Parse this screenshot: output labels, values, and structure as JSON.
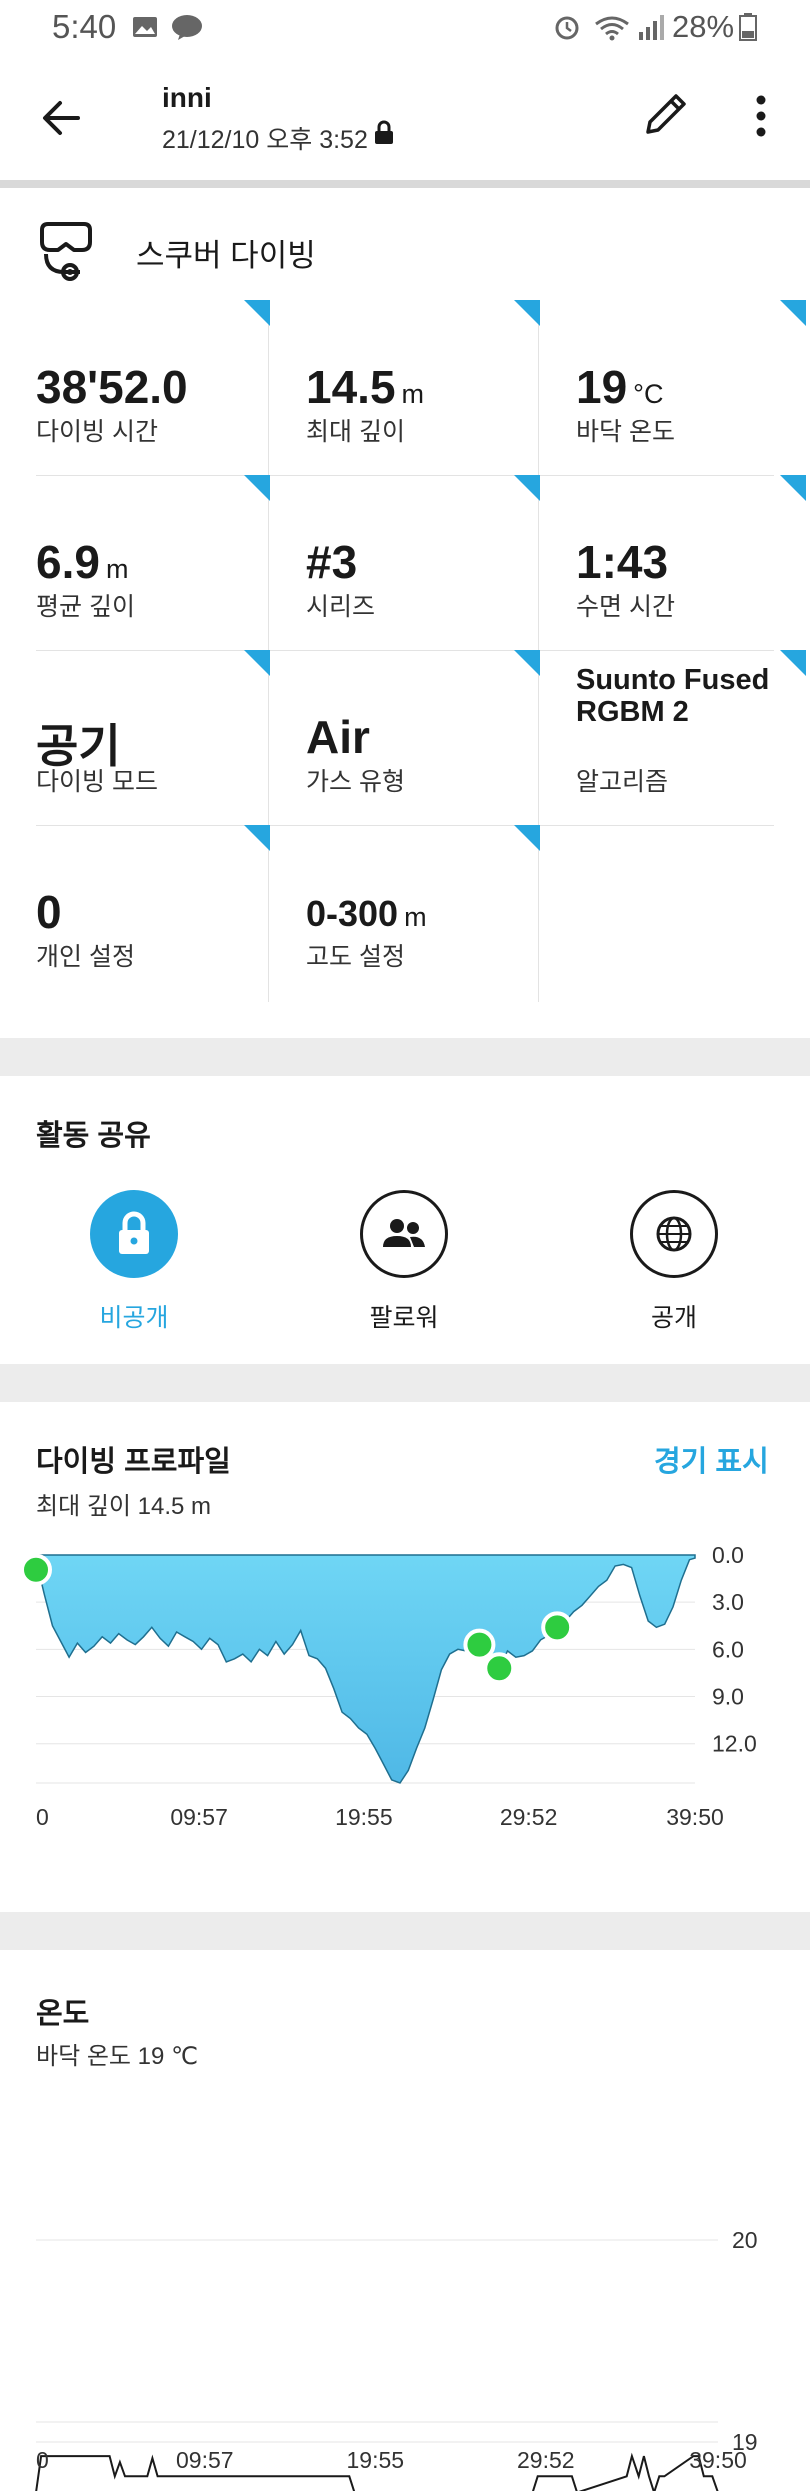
{
  "status_bar": {
    "time": "5:40",
    "battery": "28%"
  },
  "header": {
    "title": "inni",
    "subtitle": "21/12/10 오후 3:52"
  },
  "activity": {
    "type_label": "스쿠버 다이빙"
  },
  "stats": [
    {
      "value": "38'52.0",
      "unit": "",
      "label": "다이빙 시간"
    },
    {
      "value": "14.5",
      "unit": "m",
      "label": "최대 깊이"
    },
    {
      "value": "19",
      "unit": "°C",
      "label": "바닥 온도"
    },
    {
      "value": "6.9",
      "unit": "m",
      "label": "평균 깊이"
    },
    {
      "value": "#3",
      "unit": "",
      "label": "시리즈"
    },
    {
      "value": "1:43",
      "unit": "",
      "label": "수면 시간"
    },
    {
      "value": "공기",
      "unit": "",
      "label": "다이빙 모드"
    },
    {
      "value": "Air",
      "unit": "",
      "label": "가스 유형"
    },
    {
      "value": "Suunto Fused RGBM 2",
      "unit": "",
      "label": "알고리즘"
    },
    {
      "value": "0",
      "unit": "",
      "label": "개인 설정"
    },
    {
      "value": "0-300",
      "unit": "m",
      "label": "고도 설정"
    }
  ],
  "share": {
    "title": "활동 공유",
    "options": [
      {
        "label": "비공개",
        "selected": true
      },
      {
        "label": "팔로워",
        "selected": false
      },
      {
        "label": "공개",
        "selected": false
      }
    ]
  },
  "dive_profile": {
    "title": "다이빙 프로파일",
    "subtitle": "최대 깊이 14.5 m",
    "action_label": "경기 표시"
  },
  "temperature": {
    "title": "온도",
    "subtitle": "바닥 온도 19 ℃"
  },
  "colors": {
    "accent": "#26a6df",
    "depth_fill": "#5cc9ee",
    "marker": "#2ecc40"
  },
  "chart_data": [
    {
      "type": "area",
      "title": "다이빙 프로파일",
      "x_tick_labels": [
        "0",
        "09:57",
        "19:55",
        "29:52",
        "39:50"
      ],
      "y_tick_labels": [
        "0.0",
        "3.0",
        "6.0",
        "9.0",
        "12.0"
      ],
      "ylim": [
        0,
        14.5
      ],
      "y_inverted": true,
      "x_minutes": [
        0,
        0.5,
        1,
        1.5,
        2,
        2.5,
        3,
        3.5,
        4,
        4.5,
        5,
        5.5,
        6,
        6.5,
        7,
        7.5,
        8,
        8.5,
        9,
        9.5,
        10,
        10.5,
        11,
        11.5,
        12,
        12.5,
        13,
        13.5,
        14,
        14.5,
        15,
        15.5,
        16,
        16.5,
        17,
        17.5,
        18,
        18.5,
        19,
        19.5,
        20,
        20.5,
        21,
        21.5,
        22,
        22.5,
        23,
        23.5,
        24,
        24.5,
        25,
        25.5,
        26,
        26.5,
        27,
        27.5,
        28,
        28.5,
        29,
        29.5,
        30,
        30.5,
        31,
        31.5,
        32,
        32.5,
        33,
        33.5,
        34,
        34.5,
        35,
        35.5,
        36,
        36.5,
        37,
        37.5,
        38,
        38.5,
        39,
        39.5,
        39.83
      ],
      "depth_m": [
        0.3,
        2.5,
        4.5,
        5.5,
        6.5,
        5.6,
        6.2,
        5.8,
        5.2,
        5.6,
        5.0,
        5.4,
        5.7,
        5.2,
        4.6,
        5.3,
        5.8,
        4.9,
        5.2,
        5.5,
        6.0,
        5.3,
        5.7,
        6.8,
        6.6,
        6.3,
        6.8,
        6.0,
        6.4,
        5.5,
        6.3,
        5.7,
        4.8,
        6.4,
        6.6,
        7.2,
        8.5,
        10.0,
        10.4,
        11.0,
        11.4,
        12.3,
        13.3,
        14.3,
        14.5,
        13.7,
        12.3,
        11.0,
        9.2,
        7.3,
        6.3,
        6.0,
        6.1,
        5.7,
        5.7,
        6.6,
        7.2,
        6.1,
        6.5,
        6.4,
        6.1,
        5.4,
        5.1,
        4.6,
        4.2,
        3.6,
        3.2,
        2.6,
        2.0,
        1.6,
        0.7,
        0.6,
        0.8,
        2.6,
        4.2,
        4.6,
        4.4,
        3.3,
        1.6,
        0.3,
        0.2
      ],
      "markers_minutes": [
        0,
        26.8,
        28,
        31.5
      ]
    },
    {
      "type": "line",
      "title": "온도",
      "x_tick_labels": [
        "0",
        "09:57",
        "19:55",
        "29:52",
        "39:50"
      ],
      "y_tick_labels": [
        "20",
        "19"
      ],
      "ylim": [
        18.6,
        20
      ],
      "x_minutes": [
        0,
        0.3,
        1.7,
        2,
        4.3,
        4.6,
        4.9,
        5.2,
        6.5,
        6.8,
        7.1,
        7.4,
        18.3,
        18.6,
        23.3,
        23.6,
        24.0,
        24.3,
        29.0,
        29.3,
        31.3,
        31.6,
        34.5,
        34.8,
        35.2,
        35.5,
        35.8,
        36.1,
        36.4,
        36.7,
        38.4,
        38.7,
        39.0,
        39.5,
        39.83
      ],
      "temp_c": [
        18.75,
        18.93,
        18.93,
        18.93,
        18.93,
        18.83,
        18.9,
        18.83,
        18.83,
        18.92,
        18.83,
        18.83,
        18.83,
        18.75,
        18.75,
        18.68,
        18.75,
        18.75,
        18.75,
        18.83,
        18.83,
        18.75,
        18.83,
        18.93,
        18.83,
        18.93,
        18.83,
        18.75,
        18.83,
        18.83,
        18.93,
        18.93,
        18.83,
        18.83,
        18.75
      ]
    }
  ]
}
